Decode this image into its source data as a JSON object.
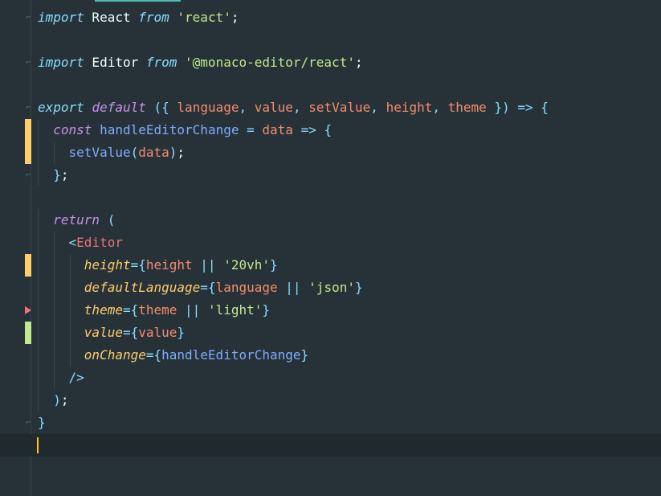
{
  "editor": {
    "lines": [
      {
        "tokens": [
          [
            "imp",
            "import"
          ],
          [
            "id",
            " React "
          ],
          [
            "imp",
            "from"
          ],
          [
            "id",
            " "
          ],
          [
            "str",
            "'react'"
          ],
          [
            "id",
            ";"
          ]
        ]
      },
      {
        "tokens": []
      },
      {
        "tokens": [
          [
            "imp",
            "import"
          ],
          [
            "id",
            " Editor "
          ],
          [
            "imp",
            "from"
          ],
          [
            "id",
            " "
          ],
          [
            "str",
            "'@monaco-editor/react'"
          ],
          [
            "id",
            ";"
          ]
        ]
      },
      {
        "tokens": []
      },
      {
        "tokens": [
          [
            "imp",
            "export"
          ],
          [
            "id",
            " "
          ],
          [
            "kw",
            "default"
          ],
          [
            "id",
            " "
          ],
          [
            "pun",
            "({"
          ],
          [
            "id",
            " "
          ],
          [
            "par",
            "language"
          ],
          [
            "pun",
            ","
          ],
          [
            "id",
            " "
          ],
          [
            "par",
            "value"
          ],
          [
            "pun",
            ","
          ],
          [
            "id",
            " "
          ],
          [
            "par",
            "setValue"
          ],
          [
            "pun",
            ","
          ],
          [
            "id",
            " "
          ],
          [
            "par",
            "height"
          ],
          [
            "pun",
            ","
          ],
          [
            "id",
            " "
          ],
          [
            "par",
            "theme"
          ],
          [
            "id",
            " "
          ],
          [
            "pun",
            "})"
          ],
          [
            "id",
            " "
          ],
          [
            "pun",
            "=>"
          ],
          [
            "id",
            " "
          ],
          [
            "pun",
            "{"
          ]
        ]
      },
      {
        "tokens": [
          [
            "id",
            "  "
          ],
          [
            "kw",
            "const"
          ],
          [
            "id",
            " "
          ],
          [
            "fn",
            "handleEditorChange"
          ],
          [
            "id",
            " "
          ],
          [
            "pun",
            "="
          ],
          [
            "id",
            " "
          ],
          [
            "par",
            "data"
          ],
          [
            "id",
            " "
          ],
          [
            "pun",
            "=>"
          ],
          [
            "id",
            " "
          ],
          [
            "pun",
            "{"
          ]
        ]
      },
      {
        "tokens": [
          [
            "id",
            "    "
          ],
          [
            "fn",
            "setValue"
          ],
          [
            "pun",
            "("
          ],
          [
            "par",
            "data"
          ],
          [
            "pun",
            ")"
          ],
          [
            "id",
            ";"
          ]
        ]
      },
      {
        "tokens": [
          [
            "id",
            "  "
          ],
          [
            "pun",
            "}"
          ],
          [
            "id",
            ";"
          ]
        ]
      },
      {
        "tokens": []
      },
      {
        "tokens": [
          [
            "id",
            "  "
          ],
          [
            "kw",
            "return"
          ],
          [
            "id",
            " "
          ],
          [
            "pun",
            "("
          ]
        ]
      },
      {
        "tokens": [
          [
            "id",
            "    "
          ],
          [
            "pun",
            "<"
          ],
          [
            "tag",
            "Editor"
          ]
        ]
      },
      {
        "tokens": [
          [
            "id",
            "      "
          ],
          [
            "attr",
            "height"
          ],
          [
            "pun",
            "={"
          ],
          [
            "par",
            "height"
          ],
          [
            "id",
            " "
          ],
          [
            "pun",
            "||"
          ],
          [
            "id",
            " "
          ],
          [
            "str",
            "'20vh'"
          ],
          [
            "pun",
            "}"
          ]
        ]
      },
      {
        "tokens": [
          [
            "id",
            "      "
          ],
          [
            "attr",
            "defaultLanguage"
          ],
          [
            "pun",
            "={"
          ],
          [
            "par",
            "language"
          ],
          [
            "id",
            " "
          ],
          [
            "pun",
            "||"
          ],
          [
            "id",
            " "
          ],
          [
            "str",
            "'json'"
          ],
          [
            "pun",
            "}"
          ]
        ]
      },
      {
        "tokens": [
          [
            "id",
            "      "
          ],
          [
            "attr",
            "theme"
          ],
          [
            "pun",
            "={"
          ],
          [
            "par",
            "theme"
          ],
          [
            "id",
            " "
          ],
          [
            "pun",
            "||"
          ],
          [
            "id",
            " "
          ],
          [
            "str",
            "'light'"
          ],
          [
            "pun",
            "}"
          ]
        ]
      },
      {
        "tokens": [
          [
            "id",
            "      "
          ],
          [
            "attr",
            "value"
          ],
          [
            "pun",
            "={"
          ],
          [
            "par",
            "value"
          ],
          [
            "pun",
            "}"
          ]
        ]
      },
      {
        "tokens": [
          [
            "id",
            "      "
          ],
          [
            "attr",
            "onChange"
          ],
          [
            "pun",
            "={"
          ],
          [
            "fn",
            "handleEditorChange"
          ],
          [
            "pun",
            "}"
          ]
        ]
      },
      {
        "tokens": [
          [
            "id",
            "    "
          ],
          [
            "pun",
            "/>"
          ]
        ]
      },
      {
        "tokens": [
          [
            "id",
            "  "
          ],
          [
            "pun",
            ")"
          ],
          [
            "id",
            ";"
          ]
        ]
      },
      {
        "tokens": [
          [
            "pun",
            "}"
          ]
        ]
      },
      {
        "tokens": []
      }
    ],
    "markers": {
      "5": "mod",
      "6": "mod",
      "11": "mod",
      "13": "del",
      "14": "add"
    },
    "folds": [
      0,
      2,
      4,
      5,
      7,
      18
    ],
    "current_line": 19,
    "colors": {
      "background": "#263238",
      "keyword": "#c792ea",
      "string": "#c3e88d",
      "parameter": "#f78c6c",
      "function": "#82aaff",
      "punctuation": "#89ddff",
      "tag": "#f07178",
      "attribute": "#ffcb6b",
      "cursor": "#ffcc00"
    }
  }
}
